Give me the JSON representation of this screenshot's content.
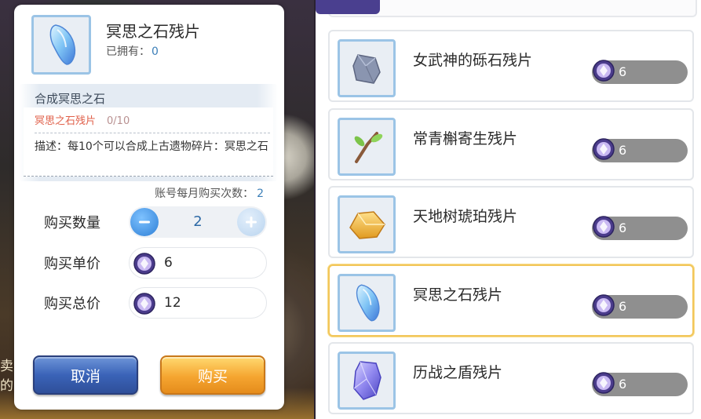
{
  "dialog": {
    "item_name": "冥思之石残片",
    "owned_label": "已拥有：",
    "owned_count": "0",
    "compose_title": "合成冥思之石",
    "fragment_label": "冥思之石残片",
    "fragment_progress": "0/10",
    "description": "描述：每10个可以合成上古遗物碎片：冥思之石",
    "monthly_label": "账号每月购买次数：",
    "monthly_count": "2",
    "quantity_label": "购买数量",
    "quantity_value": "2",
    "unit_price_label": "购买单价",
    "unit_price_value": "6",
    "total_price_label": "购买总价",
    "total_price_value": "12",
    "cancel_label": "取消",
    "buy_label": "购买"
  },
  "background": {
    "side_text": "卖的"
  },
  "shop": {
    "items": [
      {
        "name": "女武神的砾石残片",
        "price": "6",
        "icon": "grey-stone-fragment-icon",
        "selected": false
      },
      {
        "name": "常青槲寄生残片",
        "price": "6",
        "icon": "mistletoe-branch-icon",
        "selected": false
      },
      {
        "name": "天地树琥珀残片",
        "price": "6",
        "icon": "amber-fragment-icon",
        "selected": false
      },
      {
        "name": "冥思之石残片",
        "price": "6",
        "icon": "blue-crystal-fragment-icon",
        "selected": true
      },
      {
        "name": "历战之盾残片",
        "price": "6",
        "icon": "purple-shield-fragment-icon",
        "selected": false
      }
    ]
  },
  "colors": {
    "accent_blue": "#3c7fb8",
    "fragment_red": "#e0604a",
    "selected_border": "#f2c65a",
    "cancel_button": "#3a63b8",
    "buy_button": "#f5a530"
  }
}
